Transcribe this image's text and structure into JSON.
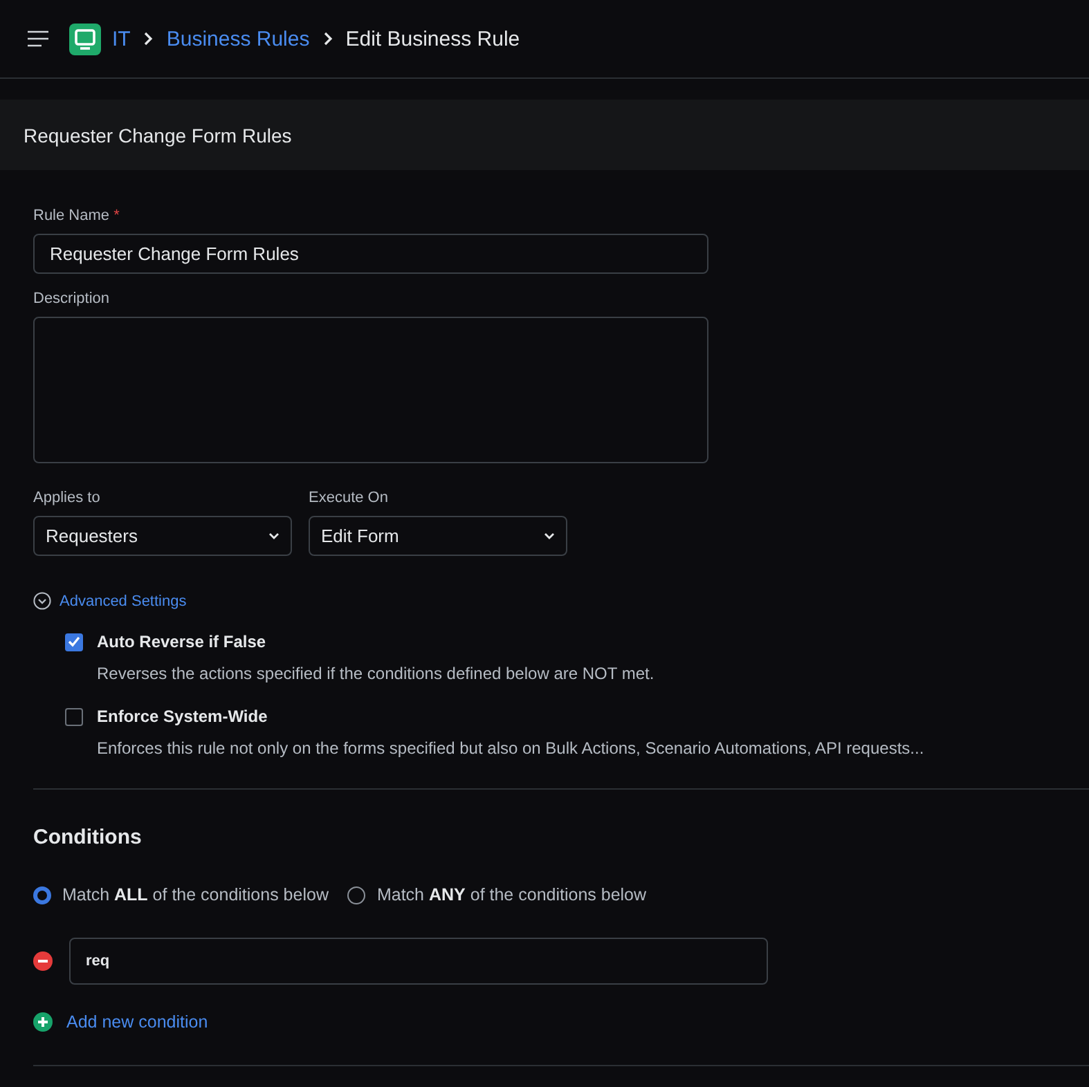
{
  "breadcrumb": [
    {
      "label": "IT",
      "kind": "link"
    },
    {
      "label": "Business Rules",
      "kind": "link"
    },
    {
      "label": "Edit Business Rule",
      "kind": "current"
    }
  ],
  "section_title": "Requester Change Form Rules",
  "rule_name": {
    "label": "Rule Name",
    "required_mark": "*",
    "value": "Requester Change Form Rules"
  },
  "description": {
    "label": "Description"
  },
  "applies_to": {
    "label": "Applies to",
    "value": "Requesters"
  },
  "execute_on": {
    "label": "Execute On",
    "value": "Edit Form"
  },
  "advanced_settings": {
    "label": "Advanced Settings",
    "expanded": true
  },
  "options": [
    {
      "label": "Auto Reverse if False",
      "hint": "Reverses the actions specified if the conditions defined below are NOT met.",
      "checked": true
    },
    {
      "label": "Enforce System-Wide",
      "hint": "Enforces this rule not only on the forms specified but also on Bulk Actions, Scenario Automations, API requests...",
      "checked": false
    }
  ],
  "conditions": {
    "title": "Conditions",
    "match": [
      {
        "label": "Match **ALL** of the conditions below",
        "selected": true
      },
      {
        "label": "Match **ANY** of the conditions below",
        "selected": false
      }
    ],
    "items": [
      {
        "value": "req"
      }
    ],
    "add_label": "Add new condition"
  }
}
